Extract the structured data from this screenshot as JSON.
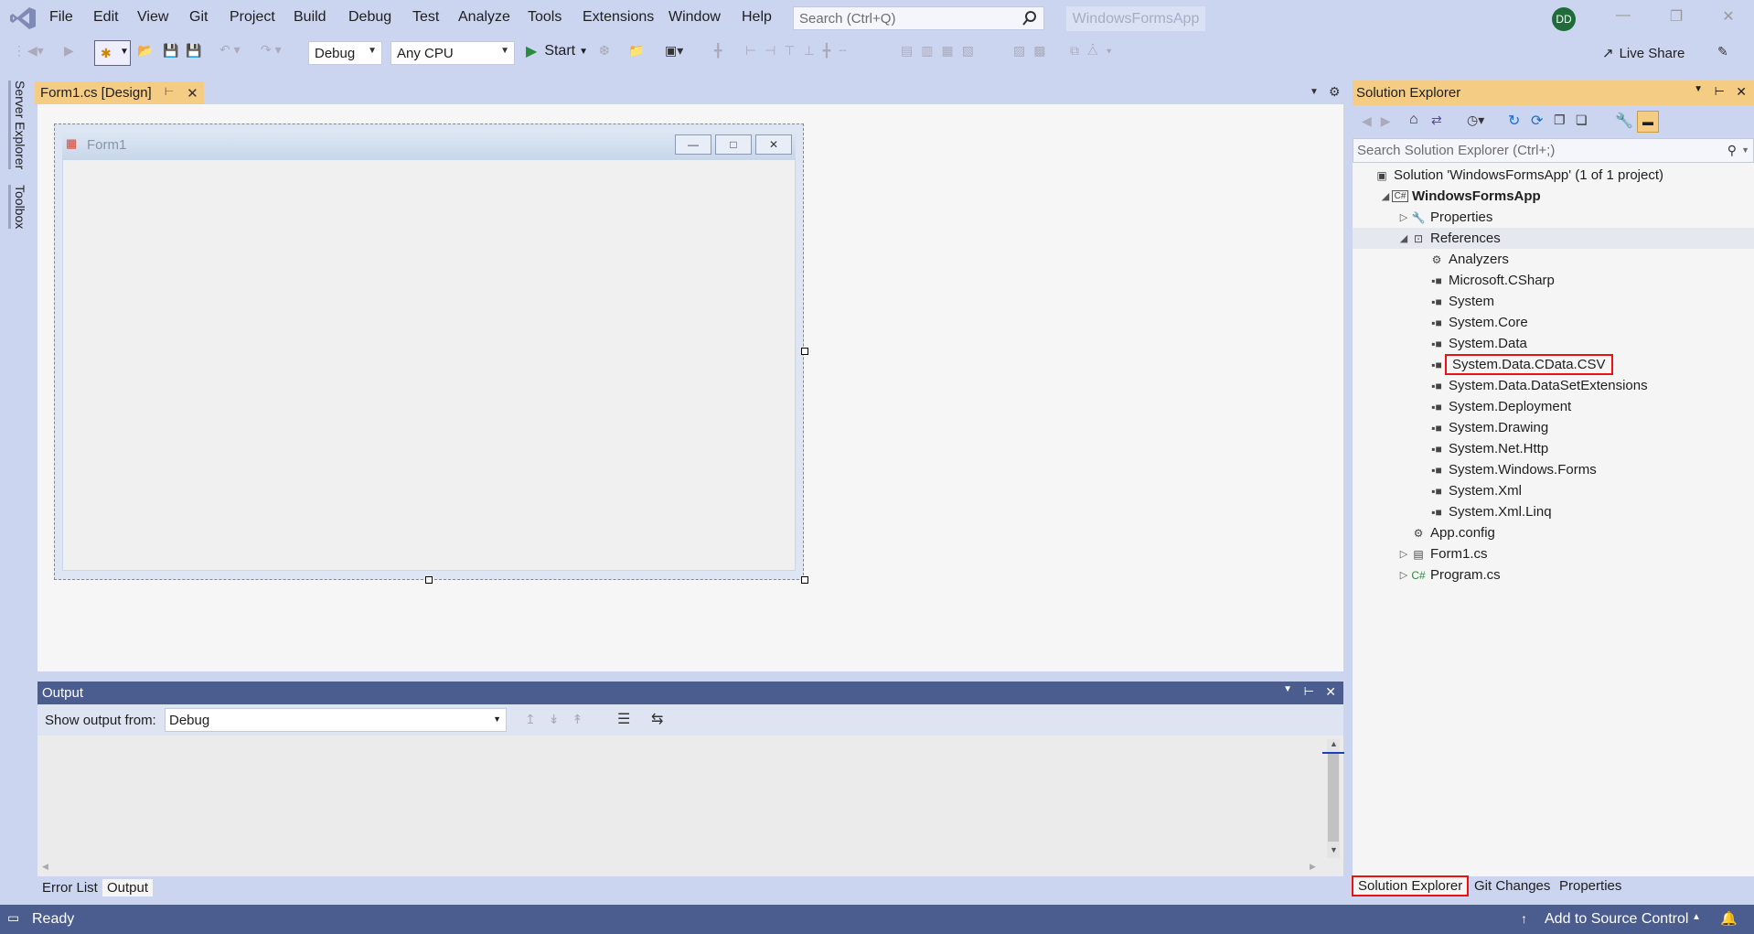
{
  "menubar": {
    "items": [
      "File",
      "Edit",
      "View",
      "Git",
      "Project",
      "Build",
      "Debug",
      "Test",
      "Analyze",
      "Tools",
      "Extensions",
      "Window",
      "Help"
    ],
    "search_placeholder": "Search (Ctrl+Q)",
    "app_name": "WindowsFormsApp",
    "avatar_initials": "DD"
  },
  "toolbar": {
    "config": "Debug",
    "platform": "Any CPU",
    "start_label": "Start",
    "live_share": "Live Share"
  },
  "left_rail": {
    "tabs": [
      "Server Explorer",
      "Toolbox"
    ]
  },
  "document": {
    "tab_label": "Form1.cs [Design]",
    "form_title": "Form1"
  },
  "output": {
    "title": "Output",
    "show_from_label": "Show output from:",
    "source": "Debug"
  },
  "bottom_tabs": [
    "Error List",
    "Output"
  ],
  "solution_explorer": {
    "title": "Solution Explorer",
    "search_placeholder": "Search Solution Explorer (Ctrl+;)",
    "tree": [
      {
        "label": "Solution 'WindowsFormsApp' (1 of 1 project)",
        "icon": "solution-icon",
        "toggle": ""
      },
      {
        "label": "WindowsFormsApp",
        "icon": "csharp-project-icon",
        "toggle": "expanded",
        "bold": true
      },
      {
        "label": "Properties",
        "icon": "wrench-icon",
        "toggle": "collapsed"
      },
      {
        "label": "References",
        "icon": "references-icon",
        "toggle": "expanded"
      },
      {
        "label": "Analyzers",
        "icon": "analyzers-icon",
        "toggle": ""
      },
      {
        "label": "Microsoft.CSharp",
        "icon": "reference-icon",
        "toggle": ""
      },
      {
        "label": "System",
        "icon": "reference-icon",
        "toggle": ""
      },
      {
        "label": "System.Core",
        "icon": "reference-icon",
        "toggle": ""
      },
      {
        "label": "System.Data",
        "icon": "reference-icon",
        "toggle": ""
      },
      {
        "label": "System.Data.CData.CSV",
        "icon": "reference-icon",
        "toggle": "",
        "highlighted": true
      },
      {
        "label": "System.Data.DataSetExtensions",
        "icon": "reference-icon",
        "toggle": ""
      },
      {
        "label": "System.Deployment",
        "icon": "reference-icon",
        "toggle": ""
      },
      {
        "label": "System.Drawing",
        "icon": "reference-icon",
        "toggle": ""
      },
      {
        "label": "System.Net.Http",
        "icon": "reference-icon",
        "toggle": ""
      },
      {
        "label": "System.Windows.Forms",
        "icon": "reference-icon",
        "toggle": ""
      },
      {
        "label": "System.Xml",
        "icon": "reference-icon",
        "toggle": ""
      },
      {
        "label": "System.Xml.Linq",
        "icon": "reference-icon",
        "toggle": ""
      },
      {
        "label": "App.config",
        "icon": "config-icon",
        "toggle": ""
      },
      {
        "label": "Form1.cs",
        "icon": "form-icon",
        "toggle": "collapsed"
      },
      {
        "label": "Program.cs",
        "icon": "csharp-file-icon",
        "toggle": "collapsed"
      }
    ],
    "bottom_tabs": [
      "Solution Explorer",
      "Git Changes",
      "Properties"
    ]
  },
  "statusbar": {
    "status": "Ready",
    "source_control": "Add to Source Control"
  },
  "colors": {
    "chrome": "#ccd5f0",
    "active_tab": "#f5cc84",
    "status_bar": "#4b5c8f",
    "highlight_box": "#ee1111"
  }
}
